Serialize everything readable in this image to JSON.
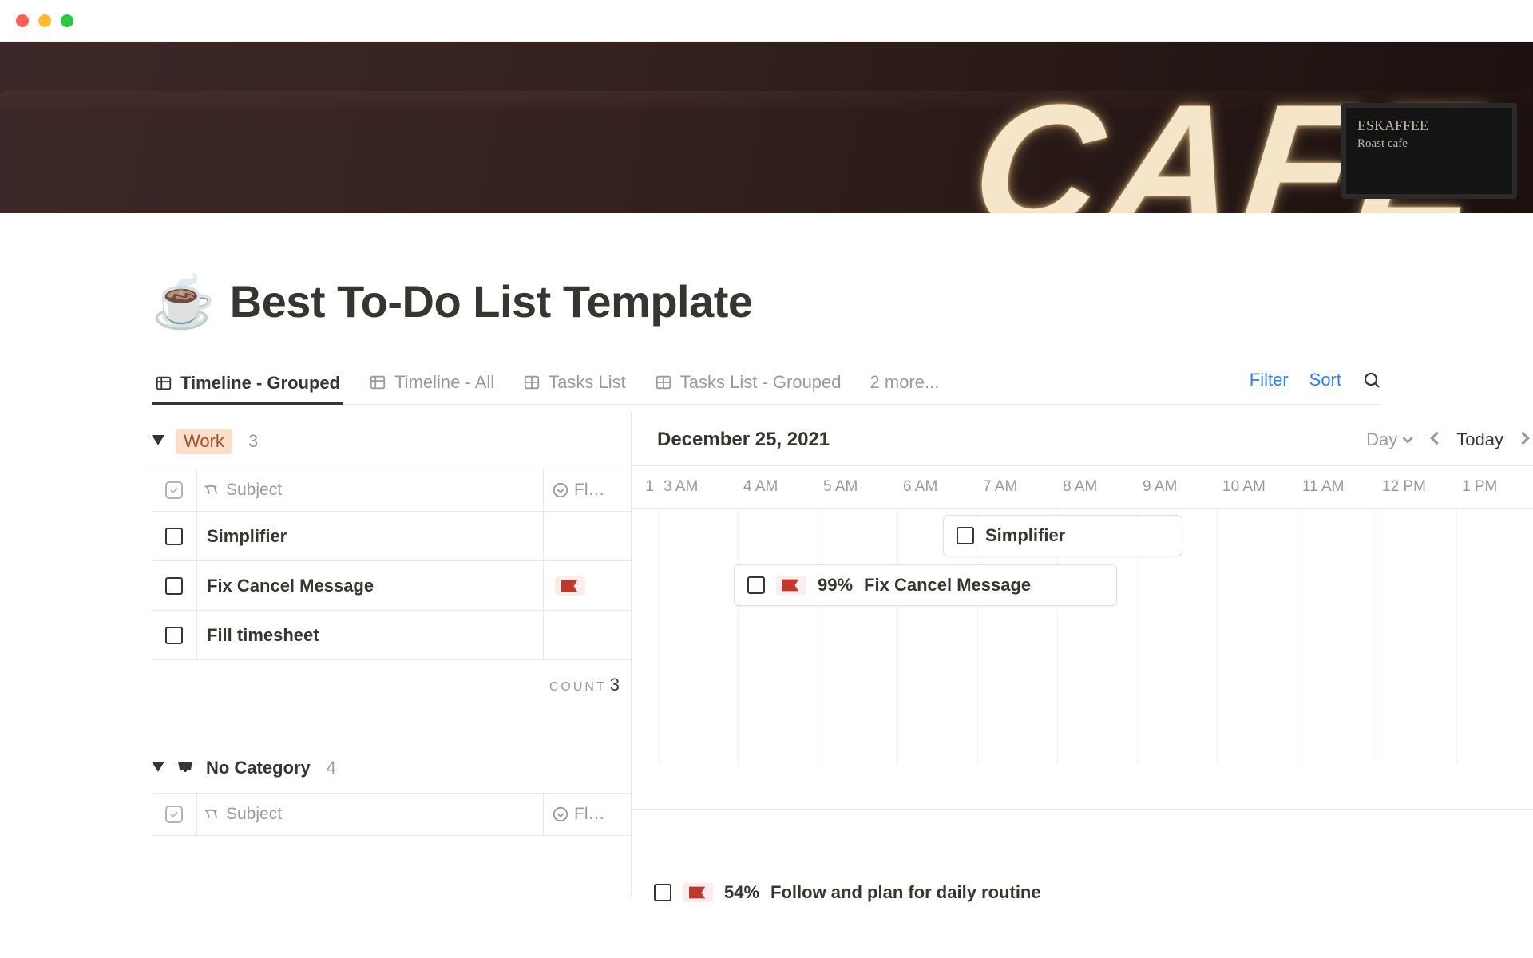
{
  "page": {
    "icon": "☕",
    "title": "Best To-Do List Template"
  },
  "cover": {
    "sign": "CAFE",
    "board_line1": "ESKAFFEE",
    "board_line2": "Roast cafe"
  },
  "tabs": [
    {
      "label": "Timeline - Grouped",
      "icon": "timeline",
      "active": true
    },
    {
      "label": "Timeline - All",
      "icon": "timeline",
      "active": false
    },
    {
      "label": "Tasks List",
      "icon": "table",
      "active": false
    },
    {
      "label": "Tasks List - Grouped",
      "icon": "table",
      "active": false
    }
  ],
  "tabs_more": "2 more...",
  "actions": {
    "filter": "Filter",
    "sort": "Sort"
  },
  "timeline": {
    "date": "December 25, 2021",
    "scale": "Day",
    "today": "Today",
    "hours": [
      "1",
      "3 AM",
      "4 AM",
      "5 AM",
      "6 AM",
      "7 AM",
      "8 AM",
      "9 AM",
      "10 AM",
      "11 AM",
      "12 PM",
      "1 PM"
    ]
  },
  "columns": {
    "subject": "Subject",
    "flag": "Fl…"
  },
  "groups": [
    {
      "name": "Work",
      "style": "orange-pill",
      "count": "3",
      "tasks": [
        {
          "subject": "Simplifier",
          "flagged": false
        },
        {
          "subject": "Fix Cancel Message",
          "flagged": true
        },
        {
          "subject": "Fill timesheet",
          "flagged": false
        }
      ],
      "footer": {
        "label": "COUNT",
        "value": "3"
      }
    },
    {
      "name": "No Category",
      "style": "plain",
      "count": "4",
      "tasks": []
    }
  ],
  "bars": {
    "simplifier": {
      "label": "Simplifier"
    },
    "fix": {
      "pct": "99%",
      "label": "Fix Cancel Message"
    },
    "peek": {
      "pct": "54%",
      "label": "Follow and plan for daily routine"
    }
  }
}
